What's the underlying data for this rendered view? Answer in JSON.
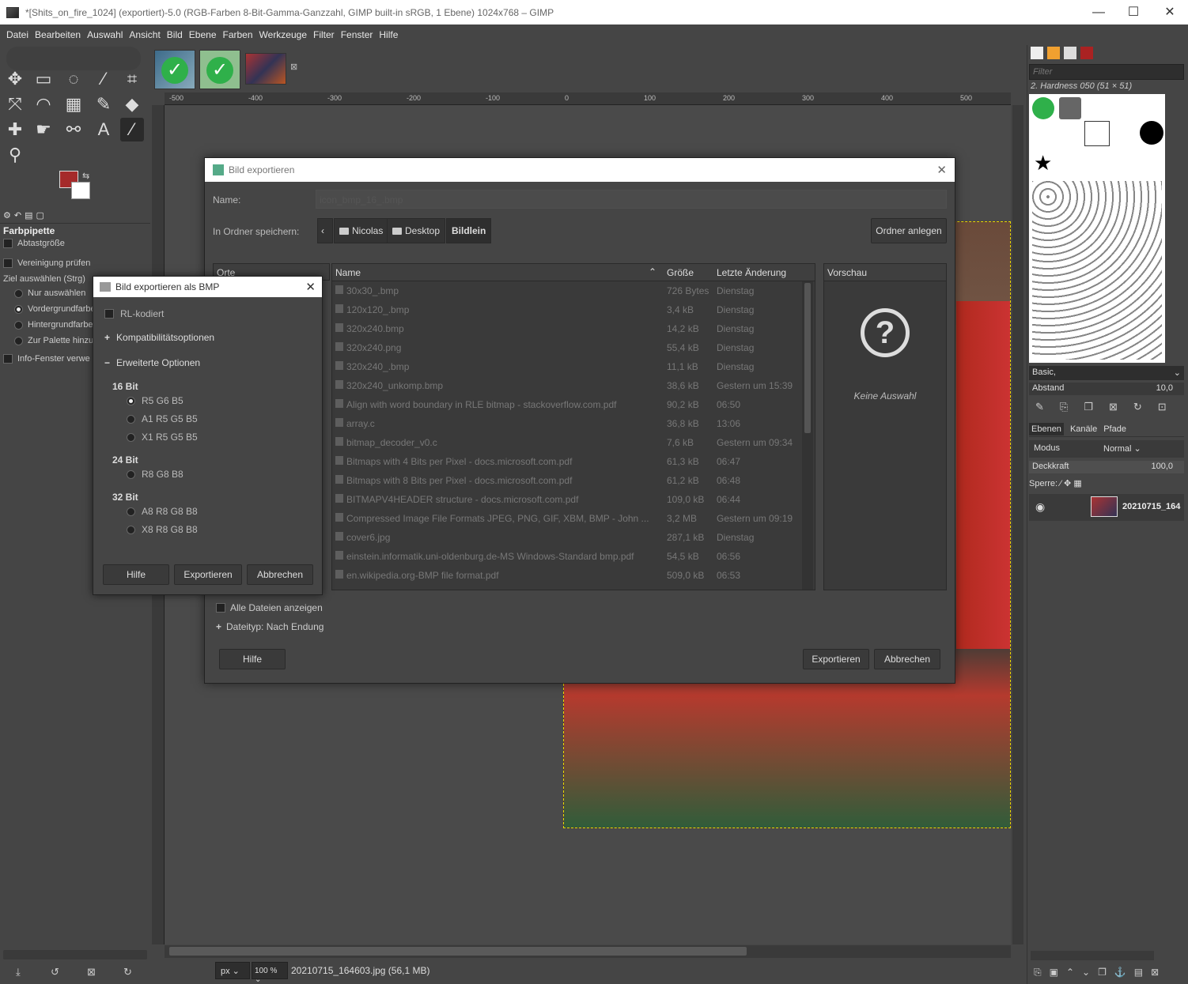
{
  "window": {
    "title": "*[Shits_on_fire_1024] (exportiert)-5.0 (RGB-Farben 8-Bit-Gamma-Ganzzahl, GIMP built-in sRGB, 1 Ebene) 1024x768 – GIMP",
    "min": "—",
    "max": "☐",
    "close": "✕"
  },
  "menu": [
    "Datei",
    "Bearbeiten",
    "Auswahl",
    "Ansicht",
    "Bild",
    "Ebene",
    "Farben",
    "Werkzeuge",
    "Filter",
    "Fenster",
    "Hilfe"
  ],
  "tool_options": {
    "title": "Farbpipette",
    "abtast": "Abtastgröße",
    "vereinigung": "Vereinigung prüfen",
    "ziel": "Ziel auswählen  (Strg)",
    "r1": "Nur auswählen",
    "r2": "Vordergrundfarbe",
    "r3": "Hintergrundfarbe",
    "r4": "Zur Palette hinzu",
    "info": "Info-Fenster verwe"
  },
  "ruler": [
    "-500",
    "-400",
    "-300",
    "-200",
    "-100",
    "0",
    "100",
    "200",
    "300",
    "400",
    "500"
  ],
  "status": {
    "unit": "px",
    "zoom": "100 %",
    "file": "20210715_164603.jpg (56,1 MB)"
  },
  "dock": {
    "filter_placeholder": "Filter",
    "brush_name": "2. Hardness 050 (51 × 51)",
    "preset": "Basic,",
    "abstand_label": "Abstand",
    "abstand_value": "10,0",
    "tab_layers": "Ebenen",
    "tab_channels": "Kanäle",
    "tab_paths": "Pfade",
    "modus_label": "Modus",
    "modus_value": "Normal",
    "opacity_label": "Deckkraft",
    "opacity_value": "100,0",
    "lock_label": "Sperre:",
    "layer_name": "20210715_164"
  },
  "export": {
    "title": "Bild exportieren",
    "name_label": "Name:",
    "name_value": "icon_bmp_16_.bmp",
    "folder_label": "In Ordner speichern:",
    "crumbs": [
      "Nicolas",
      "Desktop",
      "Bildlein"
    ],
    "new_folder": "Ordner anlegen",
    "places_header": "Orte",
    "col_name": "Name",
    "col_size": "Größe",
    "col_date": "Letzte Änderung",
    "preview_header": "Vorschau",
    "no_selection": "Keine Auswahl",
    "files": [
      {
        "name": "30x30_.bmp",
        "size": "726 Bytes",
        "date": "Dienstag"
      },
      {
        "name": "120x120_.bmp",
        "size": "3,4 kB",
        "date": "Dienstag"
      },
      {
        "name": "320x240.bmp",
        "size": "14,2 kB",
        "date": "Dienstag"
      },
      {
        "name": "320x240.png",
        "size": "55,4 kB",
        "date": "Dienstag"
      },
      {
        "name": "320x240_.bmp",
        "size": "11,1 kB",
        "date": "Dienstag"
      },
      {
        "name": "320x240_unkomp.bmp",
        "size": "38,6 kB",
        "date": "Gestern um 15:39"
      },
      {
        "name": "Align with word boundary in RLE bitmap - stackoverflow.com.pdf",
        "size": "90,2 kB",
        "date": "06:50"
      },
      {
        "name": "array.c",
        "size": "36,8 kB",
        "date": "13:06"
      },
      {
        "name": "bitmap_decoder_v0.c",
        "size": "7,6 kB",
        "date": "Gestern um 09:34"
      },
      {
        "name": "Bitmaps with 4 Bits per Pixel - docs.microsoft.com.pdf",
        "size": "61,3 kB",
        "date": "06:47"
      },
      {
        "name": "Bitmaps with 8 Bits per Pixel - docs.microsoft.com.pdf",
        "size": "61,2 kB",
        "date": "06:48"
      },
      {
        "name": "BITMAPV4HEADER structure - docs.microsoft.com.pdf",
        "size": "109,0 kB",
        "date": "06:44"
      },
      {
        "name": "Compressed Image File Formats JPEG, PNG, GIF, XBM, BMP - John ...",
        "size": "3,2 MB",
        "date": "Gestern um 09:19"
      },
      {
        "name": "cover6.jpg",
        "size": "287,1 kB",
        "date": "Dienstag"
      },
      {
        "name": "einstein.informatik.uni-oldenburg.de-MS Windows-Standard bmp.pdf",
        "size": "54,5 kB",
        "date": "06:56"
      },
      {
        "name": "en.wikipedia.org-BMP file format.pdf",
        "size": "509,0 kB",
        "date": "06:53"
      }
    ],
    "show_all": "Alle Dateien anzeigen",
    "filetype": "Dateityp: Nach Endung",
    "help": "Hilfe",
    "export_btn": "Exportieren",
    "cancel": "Abbrechen"
  },
  "bmp": {
    "title": "Bild exportieren als BMP",
    "rle": "RL-kodiert",
    "compat": "Kompatibilitätsoptionen",
    "advanced": "Erweiterte Optionen",
    "h16": "16 Bit",
    "o1": "R5 G6 B5",
    "o2": "A1 R5 G5 B5",
    "o3": "X1 R5 G5 B5",
    "h24": "24 Bit",
    "o4": "R8 G8 B8",
    "h32": "32 Bit",
    "o5": "A8 R8 G8 B8",
    "o6": "X8 R8 G8 B8",
    "help": "Hilfe",
    "export_btn": "Exportieren",
    "cancel": "Abbrechen"
  }
}
